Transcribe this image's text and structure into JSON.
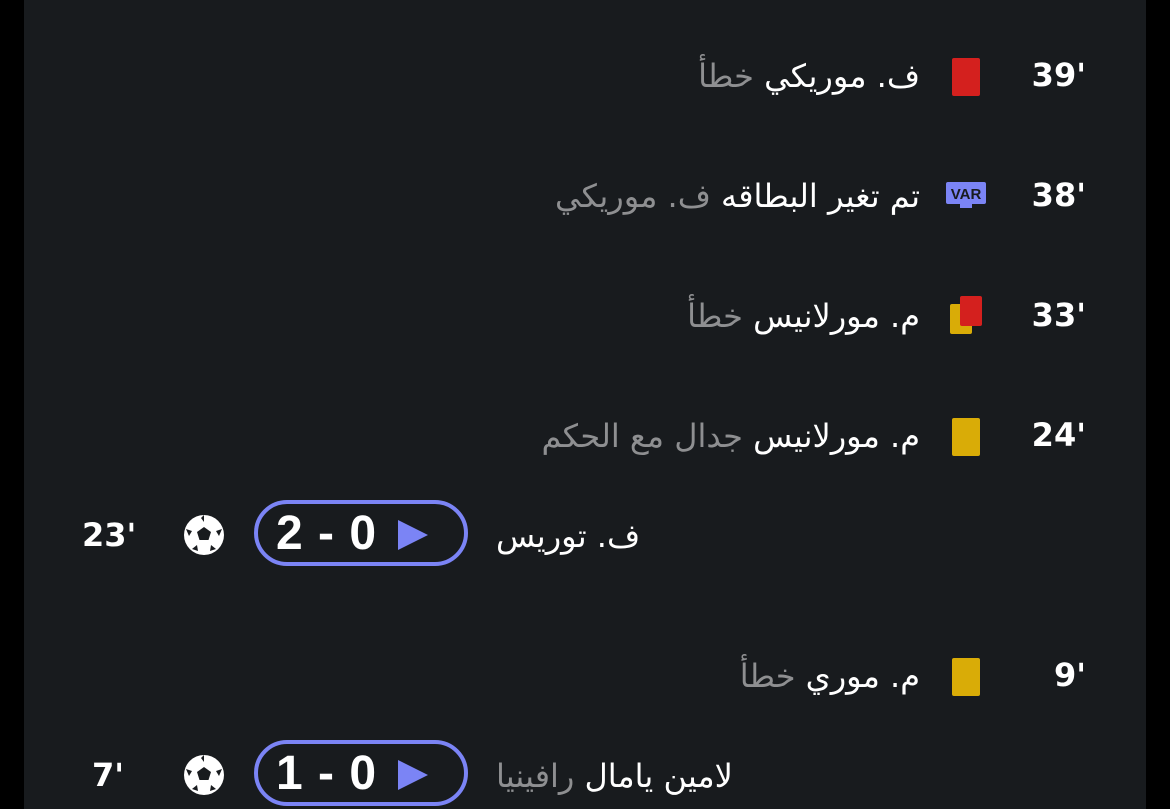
{
  "events": [
    {
      "minute": "39'",
      "type": "red-card",
      "icon": "red-card-icon",
      "player": "ف. موريكي",
      "detail": "خطأ"
    },
    {
      "minute": "38'",
      "type": "var",
      "icon": "var-icon",
      "player": "تم تغير البطاقه",
      "detail": "ف. موريكي",
      "var_label": "VAR"
    },
    {
      "minute": "33'",
      "type": "second-yellow",
      "icon": "second-yellow-red-card-icon",
      "player": "م. مورلانيس",
      "detail": "خطأ"
    },
    {
      "minute": "24'",
      "type": "yellow-card",
      "icon": "yellow-card-icon",
      "player": "م. مورلانيس",
      "detail": "جدال مع الحكم"
    },
    {
      "minute": "23'",
      "type": "goal",
      "icon": "soccer-ball-icon",
      "score": "2 - 0",
      "player": "ف. توريس",
      "detail": ""
    },
    {
      "minute": "9'",
      "type": "yellow-card",
      "icon": "yellow-card-icon",
      "player": "م. موري",
      "detail": "خطأ"
    },
    {
      "minute": "7'",
      "type": "goal",
      "icon": "soccer-ball-icon",
      "score": "1 - 0",
      "player": "لامين يامال",
      "detail": "رافينيا"
    }
  ],
  "colors": {
    "background": "#181b1e",
    "accent": "#7b84f5",
    "red_card": "#d4201e",
    "yellow_card": "#d9ac07",
    "muted_text": "#8e8f91"
  }
}
